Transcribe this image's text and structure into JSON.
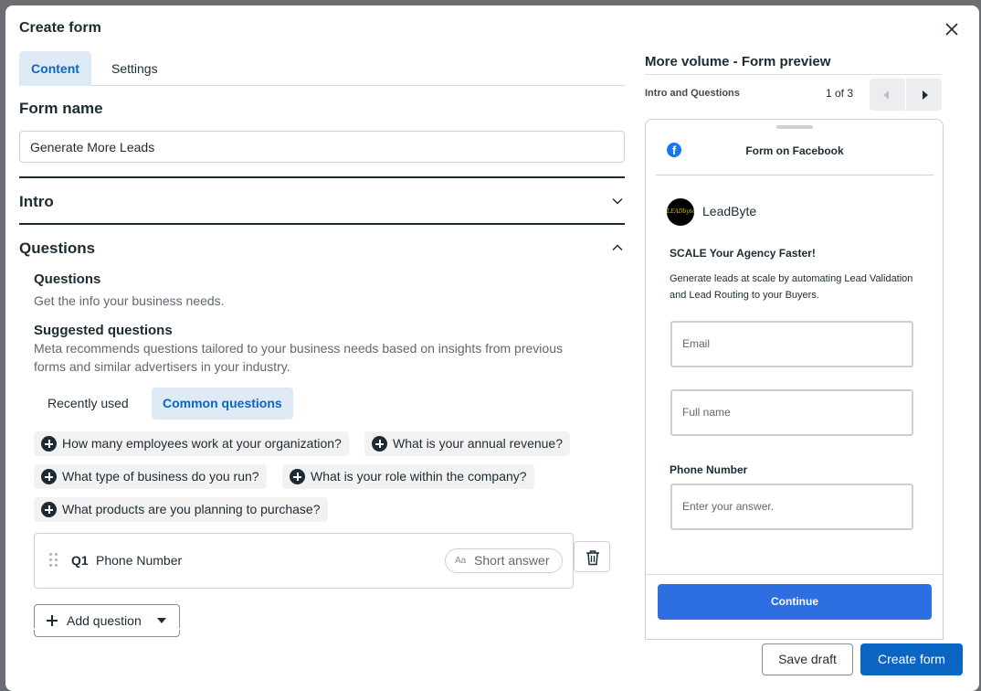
{
  "modal": {
    "title": "Create form",
    "close_icon": "close-icon"
  },
  "tabs": [
    {
      "label": "Content",
      "active": true
    },
    {
      "label": "Settings",
      "active": false
    }
  ],
  "form_name": {
    "heading": "Form name",
    "value": "Generate More Leads"
  },
  "intro": {
    "heading": "Intro",
    "expanded": false
  },
  "questions": {
    "heading": "Questions",
    "expanded": true,
    "sub_heading": "Questions",
    "sub_text": "Get the info your business needs.",
    "suggested_heading": "Suggested questions",
    "suggested_text_1": "Meta recommends questions tailored to your business needs based on insights from previous",
    "suggested_text_2": "forms and similar advertisers in your industry.",
    "filter_tabs": [
      {
        "label": "Recently used",
        "active": false
      },
      {
        "label": "Common questions",
        "active": true
      }
    ],
    "chips": [
      "How many employees work at your organization?",
      "What is your annual revenue?",
      "What type of business do you run?",
      "What is your role within the company?",
      "What products are you planning to purchase?"
    ],
    "items": [
      {
        "number": "Q1",
        "label": "Phone Number",
        "type_icon": "Aa",
        "type": "Short answer"
      }
    ],
    "add_label": "Add question"
  },
  "preview": {
    "title": "More volume - Form preview",
    "step": "Intro and Questions",
    "page": "1 of 3",
    "platform": "Form on Facebook",
    "brand": "LeadByte",
    "avatar_text": "LEADbyte",
    "headline": "SCALE Your Agency Faster!",
    "description": "Generate leads at scale by automating Lead Validation and Lead Routing to your Buyers.",
    "email_placeholder": "Email",
    "fullname_placeholder": "Full name",
    "phone_label": "Phone Number",
    "phone_placeholder": "Enter your answer.",
    "continue_label": "Continue"
  },
  "footer": {
    "save_label": "Save draft",
    "create_label": "Create form"
  },
  "colors": {
    "accent": "#0a66c2",
    "preview_button": "#2d6fe0",
    "tab_active_bg": "#dfeaf7",
    "facebook": "#1877f2"
  }
}
